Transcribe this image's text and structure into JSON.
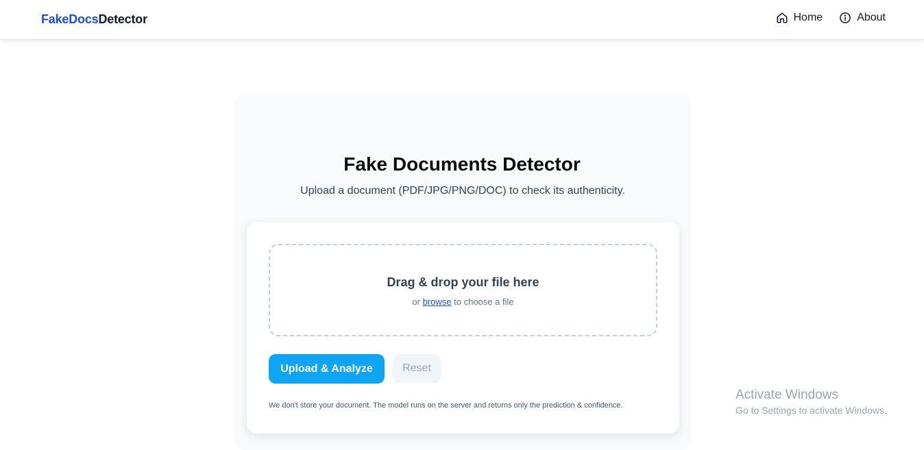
{
  "navbar": {
    "brand_part1": "FakeDocs",
    "brand_part2": "Detector",
    "links": [
      {
        "label": "Home",
        "icon": "home-icon"
      },
      {
        "label": "About",
        "icon": "info-icon"
      }
    ]
  },
  "hero": {
    "title": "Fake Documents Detector",
    "subtitle": "Upload a document (PDF/JPG/PNG/DOC) to check its authenticity."
  },
  "upload": {
    "dropzone_title": "Drag & drop your file here",
    "dropzone_prefix": "or",
    "browse_label": "browse",
    "dropzone_suffix": "to choose a file",
    "upload_button": "Upload & Analyze",
    "reset_button": "Reset",
    "disclaimer": "We don't store your document. The model runs on the server and returns only the prediction & confidence."
  },
  "watermark": {
    "title": "Activate Windows",
    "subtitle": "Go to Settings to activate Windows."
  },
  "colors": {
    "brand_blue": "#1d4ed8",
    "primary_button": "#0ea5f5",
    "panel_bg": "#f8fafc"
  }
}
